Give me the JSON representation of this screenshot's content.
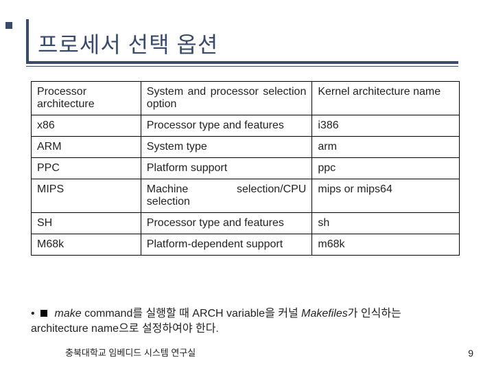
{
  "title": "프로세서 선택 옵션",
  "headers": {
    "col1": "Processor architecture",
    "col2": "System and processor selection option",
    "col3": "Kernel architecture name"
  },
  "rows": {
    "r1": {
      "arch": "x86",
      "option": "Processor type and features",
      "kernel": "i386"
    },
    "r2": {
      "arch": "ARM",
      "option": "System type",
      "kernel": "arm"
    },
    "r3": {
      "arch": "PPC",
      "option": "Platform support",
      "kernel": "ppc"
    },
    "r4": {
      "arch": "MIPS",
      "option": "Machine selection/CPU selection",
      "kernel": "mips or mips64"
    },
    "r5": {
      "arch": "SH",
      "option": "Processor type and features",
      "kernel": "sh"
    },
    "r6": {
      "arch": "M68k",
      "option": "Platform-dependent support",
      "kernel": "m68k"
    }
  },
  "note": {
    "bullet": "•",
    "pre_italic1": "",
    "italic1": "make",
    "mid1": " command를 실행할 때 ARCH variable을 커널 ",
    "italic2": "Makefiles",
    "mid2": "가 인식하는 architecture name으로 설정하여야 한다."
  },
  "footer": {
    "left": "충북대학교 임베디드 시스템 연구실",
    "right": "9"
  }
}
